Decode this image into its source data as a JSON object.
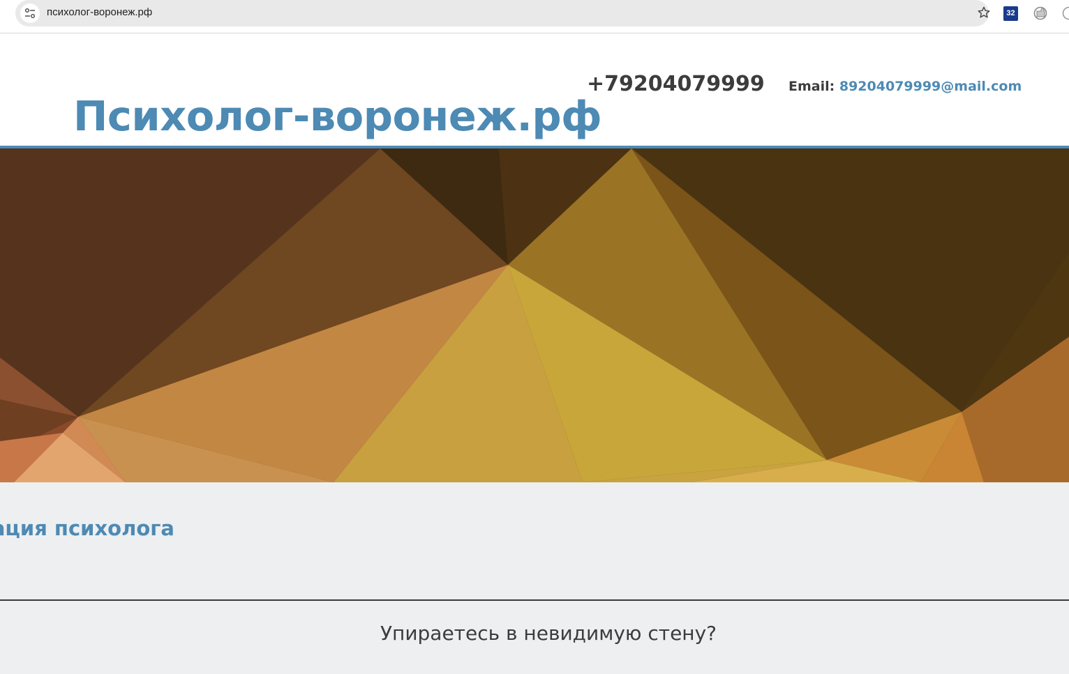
{
  "browser": {
    "url": "психолог-воронеж.рф",
    "extension_badge": "32"
  },
  "header": {
    "site_title": "Психолог-воронеж.рф",
    "phone": "+79204079999",
    "email_label": "Email:",
    "email": "89204079999@mail.com"
  },
  "main": {
    "section_heading": "ация психолога",
    "question": "Упираетесь в невидимую стену?"
  },
  "colors": {
    "brand_blue": "#4d8ab4",
    "text_dark": "#3c3c3c",
    "content_bg": "#eeeff0"
  },
  "icons": {
    "site_info": "tune-icon",
    "bookmark": "star-icon",
    "extension_1": "extension-32-icon",
    "extension_2": "extension-puzzle-icon",
    "extension_3": "extension-partial-icon"
  }
}
